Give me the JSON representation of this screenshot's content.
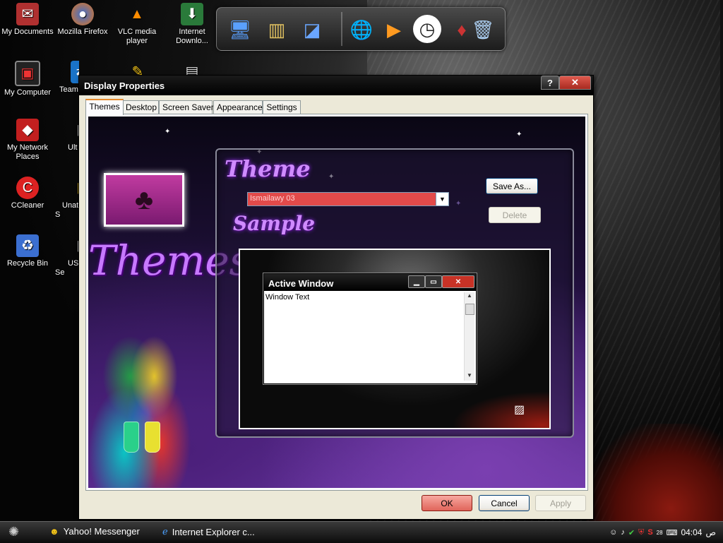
{
  "desktop": {
    "icons": [
      {
        "label": "My Documents",
        "icon": "folder-documents-icon"
      },
      {
        "label": "Mozilla Firefox",
        "icon": "firefox-icon"
      },
      {
        "label": "VLC media player",
        "icon": "vlc-icon"
      },
      {
        "label": "Internet Downlo...",
        "icon": "download-manager-icon"
      },
      {
        "label": "My Computer",
        "icon": "computer-icon"
      },
      {
        "label": "Team",
        "icon": "teamviewer-icon"
      },
      {
        "label": "My Network Places",
        "icon": "network-icon"
      },
      {
        "label": "Ult",
        "icon": "app-icon"
      },
      {
        "label": "CCleaner",
        "icon": "ccleaner-icon"
      },
      {
        "label": "Unat S",
        "icon": "app-icon"
      },
      {
        "label": "Recycle Bin",
        "icon": "recycle-bin-icon"
      },
      {
        "label": "US Se",
        "icon": "app-icon"
      }
    ]
  },
  "window": {
    "title": "Display Properties",
    "help_label": "?",
    "close_label": "✕",
    "tabs": [
      "Themes",
      "Desktop",
      "Screen Saver",
      "Appearance",
      "Settings"
    ],
    "active_tab": "Themes",
    "art_heading": "Themes",
    "theme_heading": "Theme",
    "theme_value": "Ismailawy 03",
    "save_as_label": "Save As...",
    "delete_label": "Delete",
    "sample_heading": "Sample",
    "preview": {
      "title": "Active Window",
      "body": "Window Text"
    },
    "ok_label": "OK",
    "cancel_label": "Cancel",
    "apply_label": "Apply"
  },
  "taskbar": {
    "tasks": [
      {
        "label": "Yahoo! Messenger",
        "icon": "yahoo-messenger-icon"
      },
      {
        "label": "Internet Explorer c...",
        "icon": "internet-explorer-icon"
      }
    ],
    "clock": "04:04",
    "clock_suffix": "ص",
    "tray_badge": "28"
  },
  "colors": {
    "title_bar": "#000000",
    "close_button": "#c83226",
    "ok_button": "#e8807a",
    "theme_select": "#e24a4a"
  }
}
